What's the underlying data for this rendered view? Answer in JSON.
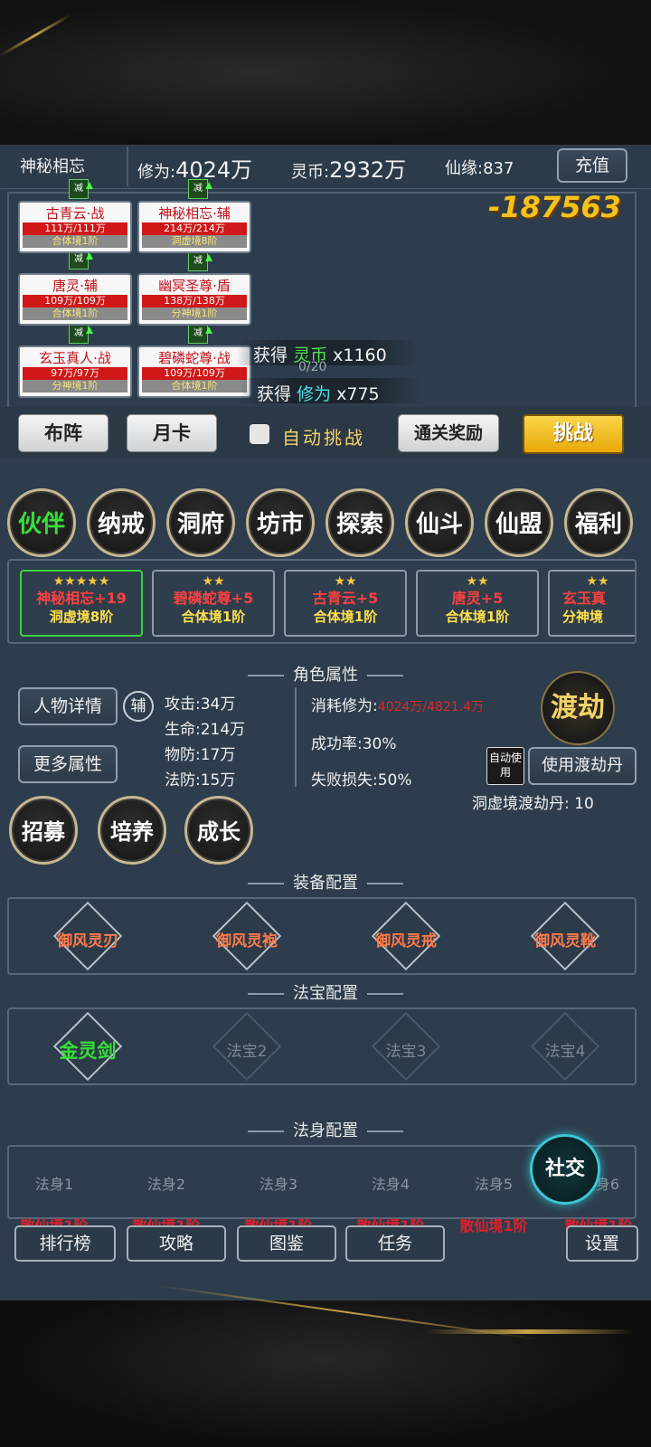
{
  "header": {
    "player_name": "神秘相忘",
    "cultivation_label": "修为:",
    "cultivation_value": "4024万",
    "coin_label": "灵币:",
    "coin_value": "2932万",
    "fate_label": "仙缘:",
    "fate_value": "837",
    "recharge_label": "充值"
  },
  "battle": {
    "damage": "-187563",
    "progress": "0/20",
    "debuff_label": "减",
    "rewards": [
      {
        "prefix": "获得",
        "item": "灵币",
        "qty": "x1160"
      },
      {
        "prefix": "获得",
        "item": "修为",
        "qty": "x775"
      }
    ],
    "units": [
      {
        "name": "古青云·战",
        "hp": "111万/111万",
        "realm": "合体境1阶"
      },
      {
        "name": "神秘相忘·辅",
        "hp": "214万/214万",
        "realm": "洞虚境8阶"
      },
      {
        "name": "唐灵·辅",
        "hp": "109万/109万",
        "realm": "合体境1阶"
      },
      {
        "name": "幽冥圣尊·盾",
        "hp": "138万/138万",
        "realm": "分神境1阶"
      },
      {
        "name": "玄玉真人·战",
        "hp": "97万/97万",
        "realm": "分神境1阶"
      },
      {
        "name": "碧磷蛇尊·战",
        "hp": "109万/109万",
        "realm": "合体境1阶"
      }
    ],
    "formation_label": "布阵",
    "monthly_card_label": "月卡",
    "auto_challenge_label": "自动挑战",
    "clear_reward_label": "通关奖励",
    "challenge_label": "挑战"
  },
  "menu": [
    "伙伴",
    "纳戒",
    "洞府",
    "坊市",
    "探索",
    "仙斗",
    "仙盟",
    "福利"
  ],
  "partners": [
    {
      "stars": "★★★★★",
      "name": "神秘相忘+19",
      "realm": "洞虚境8阶"
    },
    {
      "stars": "★★",
      "name": "碧磷蛇尊+5",
      "realm": "合体境1阶"
    },
    {
      "stars": "★★",
      "name": "古青云+5",
      "realm": "合体境1阶"
    },
    {
      "stars": "★★",
      "name": "唐灵+5",
      "realm": "合体境1阶"
    },
    {
      "stars": "★★",
      "name": "玄玉真",
      "realm": "分神境"
    }
  ],
  "attributes": {
    "title": "角色属性",
    "detail_button": "人物详情",
    "assist_badge": "辅",
    "more_button": "更多属性",
    "stats": [
      "攻击:34万",
      "生命:214万",
      "物防:17万",
      "法防:15万"
    ],
    "cost_label": "消耗修为:",
    "cost_value": "4024万/4821.4万",
    "success_rate": "成功率:30%",
    "fail_loss": "失败损失:50%",
    "tribulation_label": "渡劫",
    "auto_use_label": "自动使用",
    "use_pill_button": "使用渡劫丹",
    "pill_count": "洞虚境渡劫丹: 10",
    "actions": [
      "招募",
      "培养",
      "成长"
    ]
  },
  "equipment": {
    "title": "装备配置",
    "slots": [
      "御风灵刃",
      "御风灵袍",
      "御风灵戒",
      "御风灵靴"
    ]
  },
  "treasure": {
    "title": "法宝配置",
    "slots": [
      "金灵剑",
      "法宝2",
      "法宝3",
      "法宝4"
    ]
  },
  "body": {
    "title": "法身配置",
    "slots": [
      {
        "name": "法身1",
        "realm": "散仙境1阶"
      },
      {
        "name": "法身2",
        "realm": "散仙境1阶"
      },
      {
        "name": "法身3",
        "realm": "散仙境1阶"
      },
      {
        "name": "法身4",
        "realm": "散仙境1阶"
      },
      {
        "name": "法身5",
        "realm": "散仙境1阶"
      },
      {
        "name": "法身6",
        "realm": "散仙境1阶"
      }
    ],
    "social_label": "社交"
  },
  "bottom_nav": [
    "排行榜",
    "攻略",
    "图鉴",
    "任务",
    "设置"
  ],
  "colors": {
    "panel": "#2d3d4d",
    "accent_gold": "#e9b824",
    "hp_red": "#d01818",
    "equip_orange": "#ff7a4a",
    "legendary_green": "#35e035",
    "realm_red": "#e0202a"
  }
}
